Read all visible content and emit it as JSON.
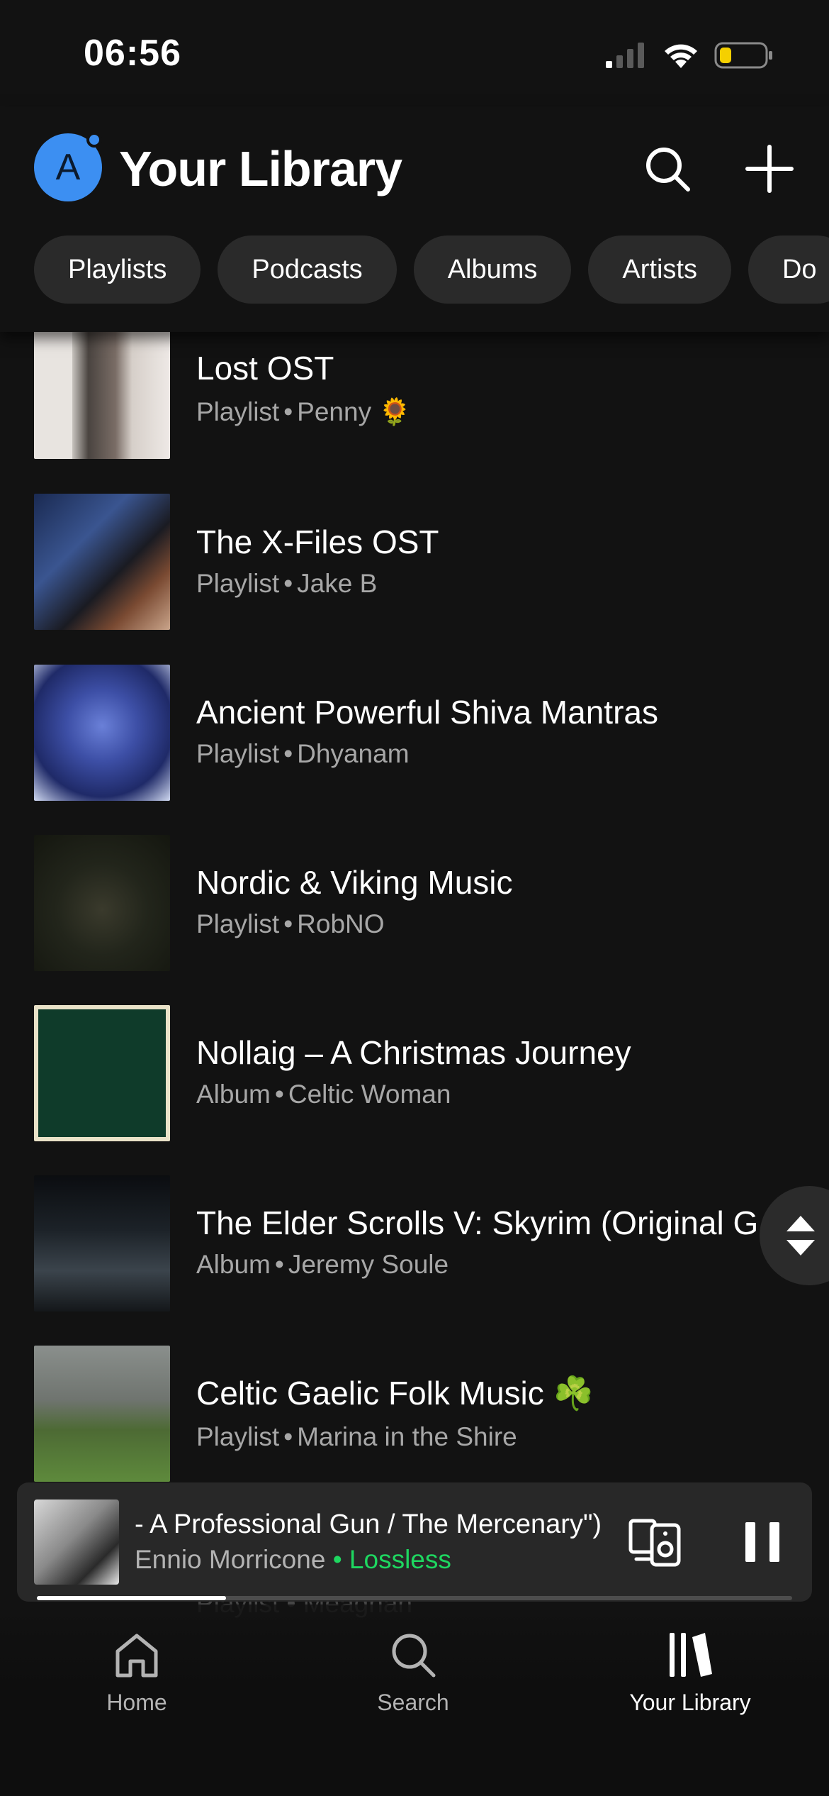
{
  "status_bar": {
    "time": "06:56"
  },
  "header": {
    "avatar_letter": "A",
    "title": "Your Library"
  },
  "filters": [
    "Playlists",
    "Podcasts",
    "Albums",
    "Artists",
    "Do"
  ],
  "library_items": [
    {
      "title": "Lost OST",
      "type": "Playlist",
      "owner": "Penny 🌻"
    },
    {
      "title": "The X-Files OST",
      "type": "Playlist",
      "owner": "Jake B"
    },
    {
      "title": "Ancient Powerful Shiva Mantras",
      "type": "Playlist",
      "owner": "Dhyanam"
    },
    {
      "title": "Nordic & Viking Music",
      "type": "Playlist",
      "owner": "RobNO"
    },
    {
      "title": "Nollaig – A Christmas Journey",
      "type": "Album",
      "owner": "Celtic Woman"
    },
    {
      "title": "The Elder Scrolls V: Skyrim (Original G",
      "type": "Album",
      "owner": "Jeremy Soule"
    },
    {
      "title": "Celtic Gaelic Folk Music ☘️",
      "type": "Playlist",
      "owner": "Marina in the Shire"
    }
  ],
  "separator": "•",
  "partial_item": {
    "subtitle": "Playlist • Meaghan"
  },
  "now_playing": {
    "title": "- A Professional Gun / The Mercenary\")",
    "artist": "Ennio Morricone",
    "quality": "• Lossless",
    "progress": 0.25
  },
  "nav": [
    {
      "label": "Home",
      "icon": "home-icon",
      "active": false
    },
    {
      "label": "Search",
      "icon": "search-icon",
      "active": false
    },
    {
      "label": "Your Library",
      "icon": "library-icon",
      "active": true
    }
  ],
  "colors": {
    "background": "#121212",
    "accent": "#1ed760",
    "avatar": "#3c8ff2",
    "chip": "#2a2a2a"
  }
}
